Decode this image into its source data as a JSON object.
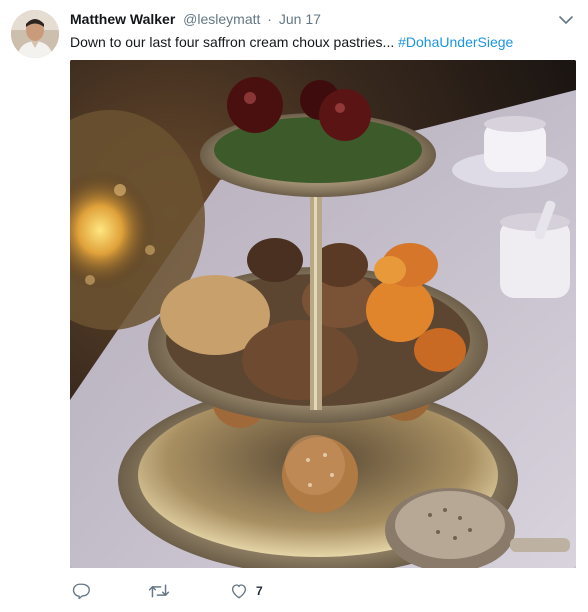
{
  "tweet": {
    "author_name": "Matthew Walker",
    "author_handle": "@lesleymatt",
    "separator": "·",
    "timestamp": "Jun 17",
    "text": "Down to our last four saffron cream choux pastries...",
    "hashtag": "#DohaUnderSiege",
    "media_alt": "Three-tier silver cake stand with pastries and dried apricots"
  },
  "actions": {
    "reply_icon": "reply-icon",
    "retweet_icon": "retweet-icon",
    "like_icon": "heart-icon",
    "like_count": "7"
  },
  "colors": {
    "link": "#1b95e0",
    "secondary_text": "#657786",
    "icon": "#657786"
  }
}
